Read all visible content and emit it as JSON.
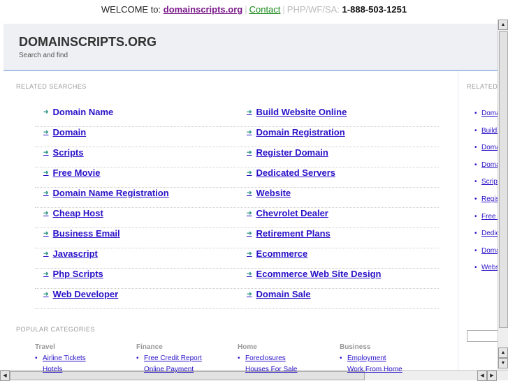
{
  "topbar": {
    "welcome": "WELCOME to:",
    "site": "domainscripts.org",
    "contact": "Contact",
    "sep": "|",
    "php": "PHP/WF/SA:",
    "phone": "1-888-503-1251"
  },
  "header": {
    "title": "DOMAINSCRIPTS.ORG",
    "tagline": "Search and find"
  },
  "related": {
    "label": "RELATED SEARCHES",
    "left": [
      "Domain Name",
      "Domain",
      "Scripts",
      "Free Movie",
      "Domain Name Registration",
      "Cheap Host",
      "Business Email",
      "Javascript",
      "Php Scripts",
      "Web Developer"
    ],
    "right": [
      "Build Website Online",
      "Domain Registration",
      "Register Domain",
      "Dedicated Servers",
      "Website",
      "Chevrolet Dealer",
      "Retirement Plans",
      "Ecommerce",
      "Ecommerce Web Site Design",
      "Domain Sale"
    ]
  },
  "sidebar": {
    "label": "RELATED",
    "items": [
      "Domain Name",
      "Build Website Online",
      "Domain",
      "Domain Registration",
      "Scripts",
      "Register Domain",
      "Free Movie",
      "Dedicated Servers",
      "Domain Name Registration",
      "Website"
    ]
  },
  "popular": {
    "label": "POPULAR CATEGORIES",
    "columns": [
      {
        "title": "Travel",
        "items": [
          "Airline Tickets",
          "Hotels"
        ]
      },
      {
        "title": "Finance",
        "items": [
          "Free Credit Report",
          "Online Payment"
        ]
      },
      {
        "title": "Home",
        "items": [
          "Foreclosures",
          "Houses For Sale"
        ]
      },
      {
        "title": "Business",
        "items": [
          "Employment",
          "Work From Home"
        ]
      }
    ]
  }
}
